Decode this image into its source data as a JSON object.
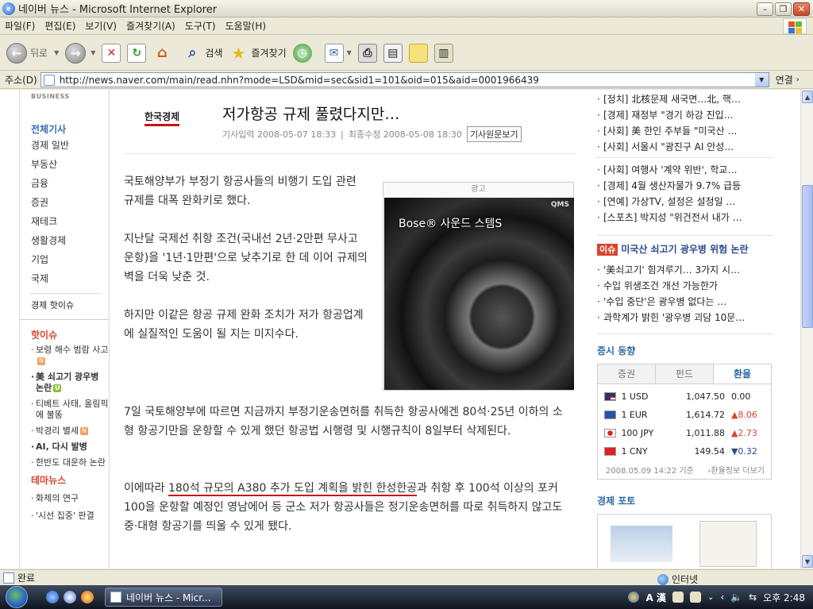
{
  "window": {
    "title": "네이버 뉴스 - Microsoft Internet Explorer"
  },
  "menu": [
    "파일(F)",
    "편집(E)",
    "보기(V)",
    "즐겨찾기(A)",
    "도구(T)",
    "도움말(H)"
  ],
  "toolbar": {
    "back_label": "뒤로",
    "search_label": "검색",
    "favorites_label": "즐겨찾기"
  },
  "address": {
    "label": "주소(D)",
    "url": "http://news.naver.com/main/read.nhn?mode=LSD&mid=sec&sid1=101&oid=015&aid=0001966439",
    "go_label": "연결"
  },
  "leftnav": {
    "business": "BUSINESS",
    "section_title": "전체기사",
    "items": [
      "경제 일반",
      "부동산",
      "금융",
      "증권",
      "재테크",
      "생활경제",
      "기업",
      "국제"
    ],
    "hot_issue_link": "경제 핫이슈",
    "hot_title": "핫이슈",
    "hot_items": [
      "보령 해수 범람 사고",
      "美 쇠고기 광우병 논란",
      "티베트 사태, 올림픽에 불똥",
      "박경리 별세",
      "AI, 다시 발병",
      "한반도 대운하 논란"
    ],
    "tag_n": "N",
    "tag_u": "U",
    "theme_title": "테마뉴스",
    "theme_items": [
      "화제의 연구",
      "'시선 집중' 판결"
    ]
  },
  "article": {
    "press": "한국경제",
    "title": "저가항공 규제 풀렸다지만…",
    "input_date": "기사입력 2008-05-07 18:33",
    "modified_date": "최종수정 2008-05-08 18:30",
    "original_button": "기사원문보기",
    "p1": "국토해양부가 부정기 항공사들의 비행기 도입 관련 규제를 대폭 완화키로 했다.",
    "p2": "지난달 국제선 취항 조건(국내선 2년·2만편 무사고 운항)을 '1년·1만편'으로 낮추기로 한 데 이어 규제의 벽을 더욱 낮춘 것.",
    "p3": "하지만 이같은 항공 규제 완화 조치가 저가 항공업계에 실질적인 도움이 될 지는 미지수다.",
    "p4": "7일 국토해양부에 따르면 지금까지 부정기운송면허를 취득한 항공사에겐 80석·25년 이하의 소형 항공기만을 운항할 수 있게 했던 항공법 시행령 및 시행규칙이 8일부터 삭제된다.",
    "p5_a": "이에따라 ",
    "p5_underlined": "180석 규모의 A380 추가 도입 계획을 밝힌 한성한공",
    "p5_b": "과 취항 후 100석 이상의 포커100을 운항할 예정인 영남에어 등 군소 저가 항공사들은 정기운송면허를 따로 취득하지 않고도 중·대형 항공기를 띄울 수 있게 됐다.",
    "ad_label": "광고",
    "ad_headline": "Bose® 사운드 스템S",
    "ad_brand": "QMS"
  },
  "right": {
    "news_top": [
      "[정치] 北核문제 새국면…北, 핵…",
      "[경제] 재정부 \"경기 하강 진입…",
      "[사회] 美 한인 주부들 \"미국산 …",
      "[사회] 서울시 \"광진구 AI 안성…"
    ],
    "news_bottom": [
      "[사회] 여행사 '계약 위반', 학교…",
      "[경제] 4월 생산자물가 9.7% 급등",
      "[연예] 가상TV, 설정은 설정일 …",
      "[스포츠] 박지성 \"위건전서 내가 …"
    ],
    "issue_badge": "이슈",
    "issue_title": "미국산 쇠고기 광우병 위험 논란",
    "issue_items": [
      "'美쇠고기' 힘겨루기… 3가지 시…",
      "수입 위생조건 개선 가능한가",
      "'수입 중단'은 광우병 없다는 …",
      "과학계가 밝힌 '광우병 괴담 10문…"
    ],
    "stock_title": "증시 동향",
    "stock_tabs": [
      "증권",
      "펀드",
      "환율"
    ],
    "rates": [
      {
        "cur": "1 USD",
        "val": "1,047.50",
        "chg": "0.00",
        "dir": "none"
      },
      {
        "cur": "1 EUR",
        "val": "1,614.72",
        "chg": "▲8.06",
        "dir": "up"
      },
      {
        "cur": "100 JPY",
        "val": "1,011.88",
        "chg": "▲2.73",
        "dir": "up"
      },
      {
        "cur": "1 CNY",
        "val": "149.54",
        "chg": "▼0.32",
        "dir": "down"
      }
    ],
    "rate_date": "2008.05.09 14:22 기준",
    "rate_more": "›환율정보 더보기",
    "photo_title": "경제 포토"
  },
  "status": {
    "text": "완료",
    "zone": "인터넷"
  },
  "taskbar": {
    "task_label": "네이버 뉴스 - Micr...",
    "ime": "A 漢",
    "clock": "오후 2:48"
  },
  "colors": {
    "accent_red": "#c81414",
    "link_blue": "#2b6aa6",
    "issue_red": "#d9442c"
  }
}
